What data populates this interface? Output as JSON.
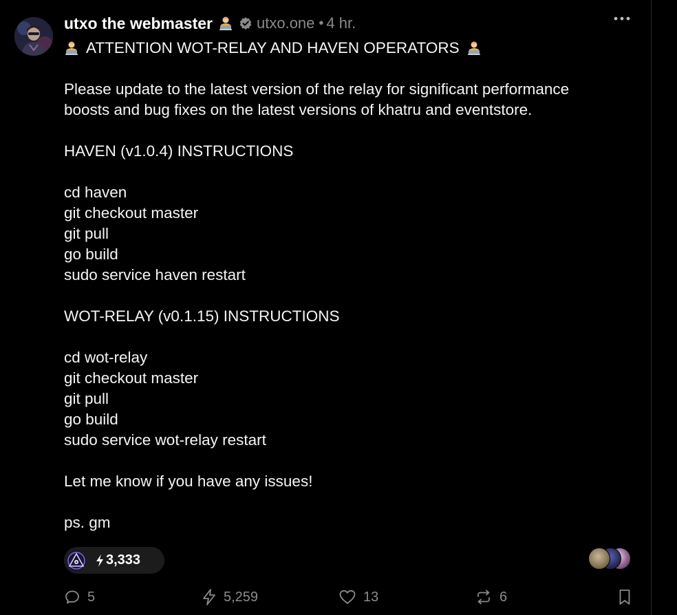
{
  "post": {
    "author_name": "utxo the webmaster",
    "author_emoji": "technologist-emoji",
    "nip05": "utxo.one",
    "separator": "•",
    "time": "4 hr.",
    "content": {
      "headline": "ATTENTION WOT-RELAY AND HAVEN OPERATORS",
      "intro_line_1": "Please update to the latest version of the relay for significant performance",
      "intro_line_2": "boosts and bug fixes on the latest versions of khatru and eventstore.",
      "haven_heading": "HAVEN (v1.0.4) INSTRUCTIONS",
      "haven_commands": [
        "cd haven",
        "git checkout master",
        "git pull",
        "go build",
        "sudo service haven restart"
      ],
      "wot_heading": "WOT-RELAY (v0.1.15) INSTRUCTIONS",
      "wot_commands": [
        "cd wot-relay",
        "git checkout master",
        "git pull",
        "go build",
        "sudo service wot-relay restart"
      ],
      "closing": "Let me know if you have any issues!",
      "ps": "ps. gm"
    }
  },
  "top_zap": {
    "amount": "3,333"
  },
  "actions": {
    "replies": "5",
    "zaps": "5,259",
    "likes": "13",
    "reposts": "6"
  },
  "icons": {
    "more": "more-horizontal-icon",
    "verified": "verified-badge-icon",
    "reply": "reply-icon",
    "zap": "zap-bolt-icon",
    "like": "heart-icon",
    "repost": "repost-icon",
    "bookmark": "bookmark-icon"
  },
  "colors": {
    "background": "#000000",
    "text": "#f5f5f5",
    "muted": "#8c8c8c",
    "pill": "#1c1c1c"
  }
}
